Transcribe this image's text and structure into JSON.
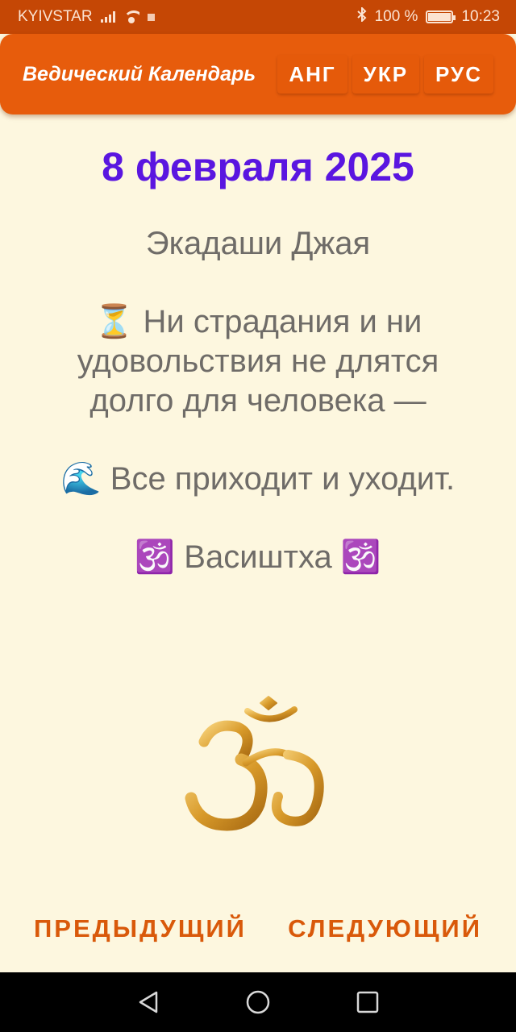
{
  "status_bar": {
    "carrier": "KYIVSTAR",
    "battery": "100 %",
    "time": "10:23"
  },
  "app_bar": {
    "title": "Ведический Календарь",
    "languages": [
      "АНГ",
      "УКР",
      "РУС"
    ]
  },
  "main": {
    "date": "8 февраля 2025",
    "lines": [
      "Экадаши Джая",
      "⏳ Ни страдания и ни удовольствия не длятся долго для человека —",
      "🌊 Все приходит и уходит.",
      "🕉️ Васиштха 🕉️"
    ]
  },
  "bottom_nav": {
    "prev_label": "ПРЕДЫДУЩИЙ",
    "next_label": "СЛЕДУЮЩИЙ"
  },
  "colors": {
    "app_bar": "#e75c0c",
    "status_bar": "#c54705",
    "background": "#fdf7df",
    "date": "#5a16e0",
    "nav_text": "#d9590a"
  },
  "icons": [
    "signal-icon",
    "wifi-icon",
    "bluetooth-icon",
    "battery-icon",
    "om-symbol",
    "back-icon",
    "home-icon",
    "recents-icon"
  ]
}
